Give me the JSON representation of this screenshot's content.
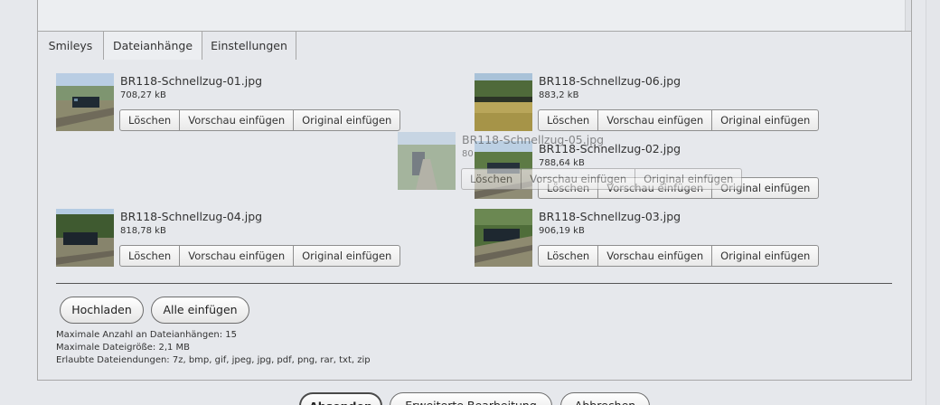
{
  "tabs": [
    {
      "label": "Smileys",
      "active": false
    },
    {
      "label": "Dateianhänge",
      "active": true
    },
    {
      "label": "Einstellungen",
      "active": false
    }
  ],
  "attachment_buttons": {
    "delete": "Löschen",
    "insert_preview": "Vorschau einfügen",
    "insert_original": "Original einfügen"
  },
  "attachments": [
    {
      "name": "BR118-Schnellzug-01.jpg",
      "size": "708,27 kB"
    },
    {
      "name": "BR118-Schnellzug-06.jpg",
      "size": "883,2 kB"
    },
    {
      "name": "BR118-Schnellzug-02.jpg",
      "size": "788,64 kB"
    },
    {
      "name": "BR118-Schnellzug-04.jpg",
      "size": "818,78 kB"
    },
    {
      "name": "BR118-Schnellzug-03.jpg",
      "size": "906,19 kB"
    }
  ],
  "dragged_attachment": {
    "name": "BR118-Schnellzug-05.jpg",
    "size": "80"
  },
  "actions": {
    "upload": "Hochladen",
    "insert_all": "Alle einfügen"
  },
  "info": {
    "max_count": "Maximale Anzahl an Dateianhängen: 15",
    "max_size": "Maximale Dateigröße: 2,1 MB",
    "allowed_ext": "Erlaubte Dateiendungen: 7z, bmp, gif, jpeg, jpg, pdf, png, rar, txt, zip"
  },
  "footer_buttons": {
    "submit": "Absenden",
    "advanced": "Erweiterte Bearbeitung",
    "cancel": "Abbrechen"
  }
}
